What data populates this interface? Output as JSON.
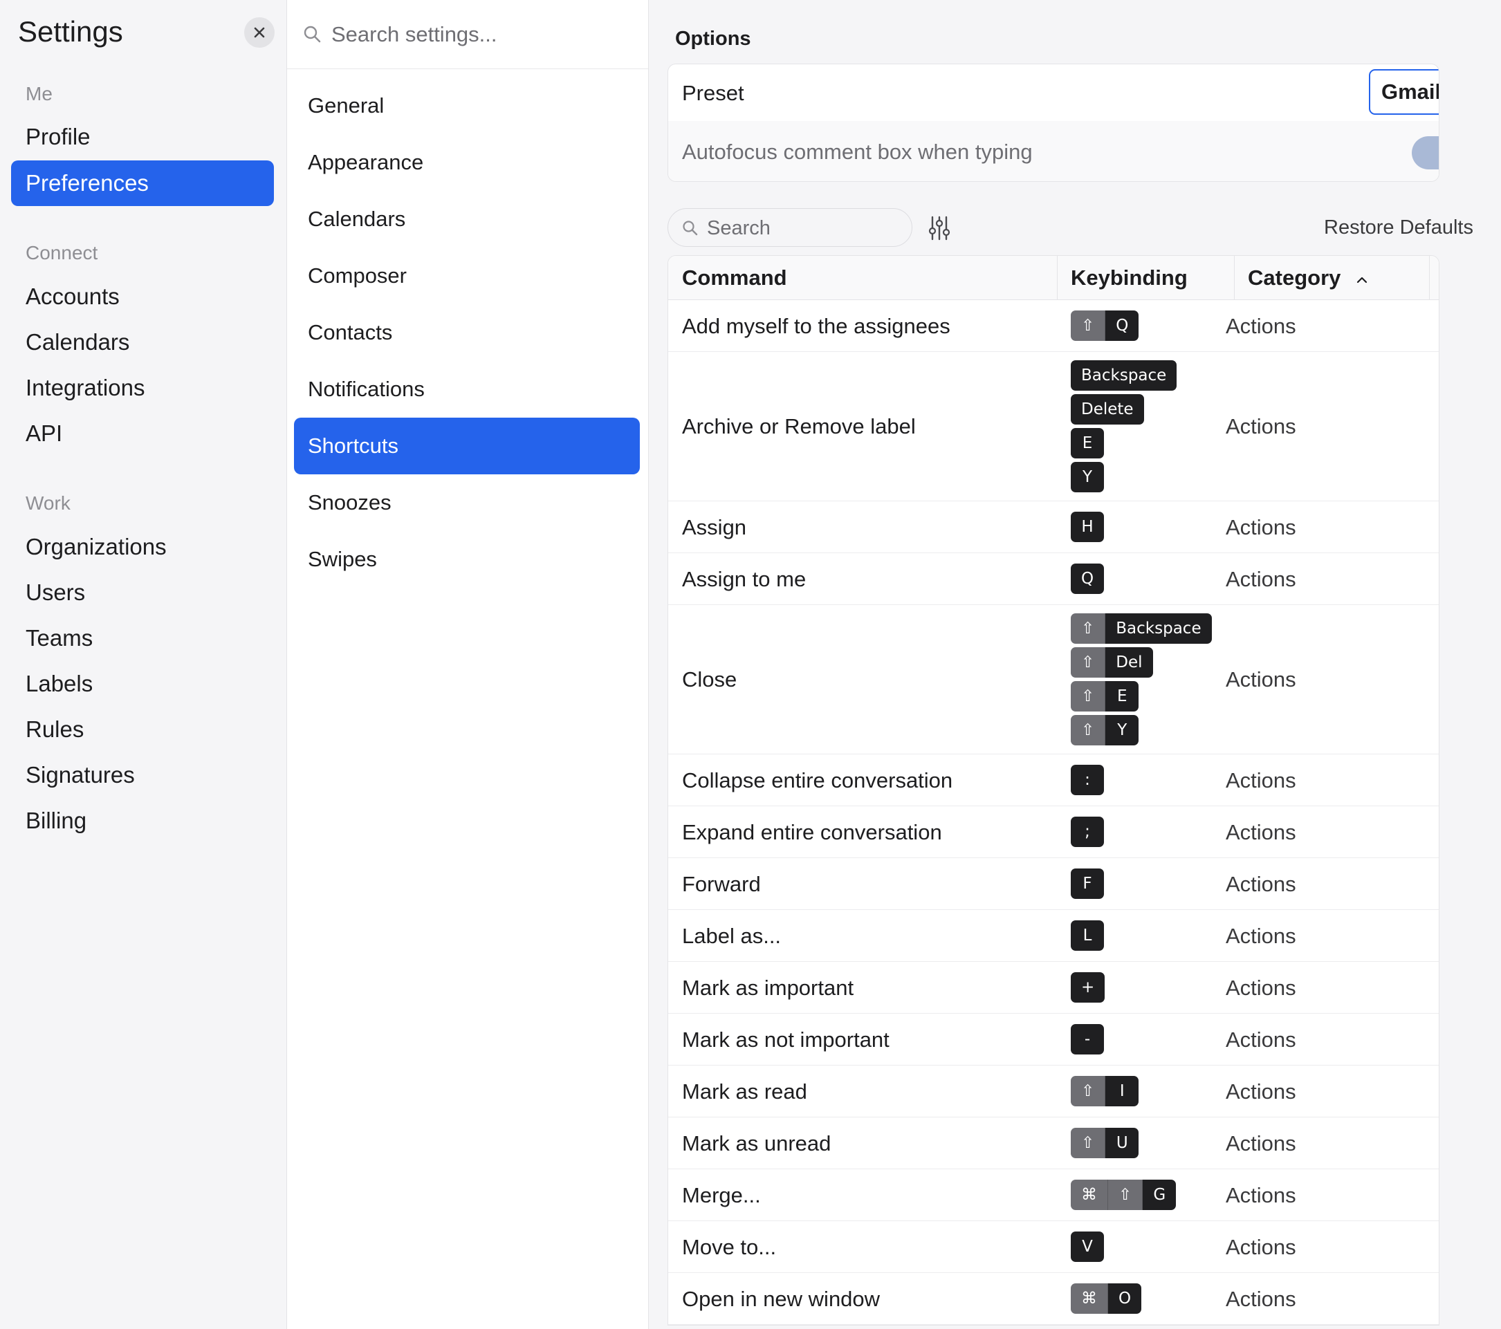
{
  "sidebar": {
    "title": "Settings",
    "sections": [
      {
        "label": "Me",
        "items": [
          {
            "label": "Profile",
            "active": false
          },
          {
            "label": "Preferences",
            "active": true
          }
        ]
      },
      {
        "label": "Connect",
        "items": [
          {
            "label": "Accounts"
          },
          {
            "label": "Calendars"
          },
          {
            "label": "Integrations"
          },
          {
            "label": "API"
          }
        ]
      },
      {
        "label": "Work",
        "items": [
          {
            "label": "Organizations"
          },
          {
            "label": "Users"
          },
          {
            "label": "Teams"
          },
          {
            "label": "Labels"
          },
          {
            "label": "Rules"
          },
          {
            "label": "Signatures"
          },
          {
            "label": "Billing"
          }
        ]
      }
    ]
  },
  "midnav": {
    "search_placeholder": "Search settings...",
    "items": [
      "General",
      "Appearance",
      "Calendars",
      "Composer",
      "Contacts",
      "Notifications",
      "Shortcuts",
      "Snoozes",
      "Swipes"
    ],
    "active_index": 6
  },
  "options": {
    "title": "Options",
    "preset_label": "Preset",
    "preset_value": "Gmail",
    "autofocus_label": "Autofocus comment box when typing",
    "autofocus_enabled": true
  },
  "table_tools": {
    "search_placeholder": "Search",
    "restore_label": "Restore Defaults"
  },
  "table": {
    "headers": {
      "command": "Command",
      "keybinding": "Keybinding",
      "category": "Category"
    },
    "sort": {
      "column": "Category",
      "direction": "ascending"
    },
    "rows": [
      {
        "command": "Add myself to the assignees",
        "keys": [
          [
            "⇧",
            "Q"
          ]
        ],
        "category": "Actions",
        "enabled": true
      },
      {
        "command": "Archive or Remove label",
        "keys": [
          [
            "Backspace"
          ],
          [
            "Delete"
          ],
          [
            "E"
          ],
          [
            "Y"
          ]
        ],
        "category": "Actions",
        "enabled": true
      },
      {
        "command": "Assign",
        "keys": [
          [
            "H"
          ]
        ],
        "category": "Actions",
        "enabled": true
      },
      {
        "command": "Assign to me",
        "keys": [
          [
            "Q"
          ]
        ],
        "category": "Actions",
        "enabled": true
      },
      {
        "command": "Close",
        "keys": [
          [
            "⇧",
            "Backspace"
          ],
          [
            "⇧",
            "Del"
          ],
          [
            "⇧",
            "E"
          ],
          [
            "⇧",
            "Y"
          ]
        ],
        "category": "Actions",
        "enabled": true
      },
      {
        "command": "Collapse entire conversation",
        "keys": [
          [
            ":"
          ]
        ],
        "category": "Actions",
        "enabled": true
      },
      {
        "command": "Expand entire conversation",
        "keys": [
          [
            ";"
          ]
        ],
        "category": "Actions",
        "enabled": true
      },
      {
        "command": "Forward",
        "keys": [
          [
            "F"
          ]
        ],
        "category": "Actions",
        "enabled": true
      },
      {
        "command": "Label as...",
        "keys": [
          [
            "L"
          ]
        ],
        "category": "Actions",
        "enabled": true
      },
      {
        "command": "Mark as important",
        "keys": [
          [
            "+"
          ]
        ],
        "category": "Actions",
        "enabled": true
      },
      {
        "command": "Mark as not important",
        "keys": [
          [
            "-"
          ]
        ],
        "category": "Actions",
        "enabled": true
      },
      {
        "command": "Mark as read",
        "keys": [
          [
            "⇧",
            "I"
          ]
        ],
        "category": "Actions",
        "enabled": true
      },
      {
        "command": "Mark as unread",
        "keys": [
          [
            "⇧",
            "U"
          ]
        ],
        "category": "Actions",
        "enabled": true
      },
      {
        "command": "Merge...",
        "keys": [
          [
            "⌘",
            "⇧",
            "G"
          ]
        ],
        "category": "Actions",
        "enabled": true
      },
      {
        "command": "Move to...",
        "keys": [
          [
            "V"
          ]
        ],
        "category": "Actions",
        "enabled": true
      },
      {
        "command": "Open in new window",
        "keys": [
          [
            "⌘",
            "O"
          ]
        ],
        "category": "Actions",
        "enabled": true
      }
    ]
  },
  "colors": {
    "accent": "#2563eb",
    "checkbox": "#1a73e8",
    "sidebar_bg": "#f5f5f7",
    "key_bg": "#1f1f21",
    "modifier_bg": "#6e6e73"
  },
  "icons": {
    "close": "close-icon",
    "search": "search-icon",
    "filter": "sliders-icon",
    "sort": "chevron-up-icon",
    "check": "checkmark-icon",
    "select": "chevron-updown-icon"
  }
}
